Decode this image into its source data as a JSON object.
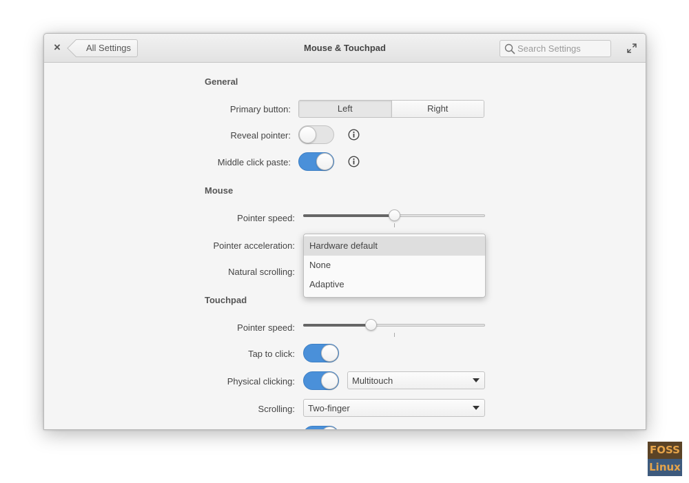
{
  "header": {
    "close_label": "×",
    "back_label": "All Settings",
    "title": "Mouse & Touchpad",
    "search_placeholder": "Search Settings"
  },
  "general": {
    "title": "General",
    "primary_button_label": "Primary button:",
    "primary_options": [
      "Left",
      "Right"
    ],
    "primary_selected": "Left",
    "reveal_pointer_label": "Reveal pointer:",
    "reveal_pointer_on": false,
    "middle_click_label": "Middle click paste:",
    "middle_click_on": true
  },
  "mouse": {
    "title": "Mouse",
    "pointer_speed_label": "Pointer speed:",
    "pointer_speed_fraction": 0.5,
    "pointer_accel_label": "Pointer acceleration:",
    "natural_scrolling_label": "Natural scrolling:",
    "accel_options": [
      "Hardware default",
      "None",
      "Adaptive"
    ],
    "accel_selected": "Hardware default"
  },
  "touchpad": {
    "title": "Touchpad",
    "pointer_speed_label": "Pointer speed:",
    "pointer_speed_fraction": 0.37,
    "tap_to_click_label": "Tap to click:",
    "tap_to_click_on": true,
    "physical_clicking_label": "Physical clicking:",
    "physical_clicking_on": true,
    "physical_clicking_mode": "Multitouch",
    "scrolling_label": "Scrolling:",
    "scrolling_mode": "Two-finger"
  },
  "watermark": {
    "line1": "FOSS",
    "line2": "Linux"
  },
  "colors": {
    "accent": "#4a90d9",
    "window_bg": "#f5f5f5"
  },
  "icons": [
    "close-icon",
    "back-arrow-icon",
    "search-icon",
    "maximize-icon",
    "info-icon",
    "chevron-down-icon"
  ]
}
